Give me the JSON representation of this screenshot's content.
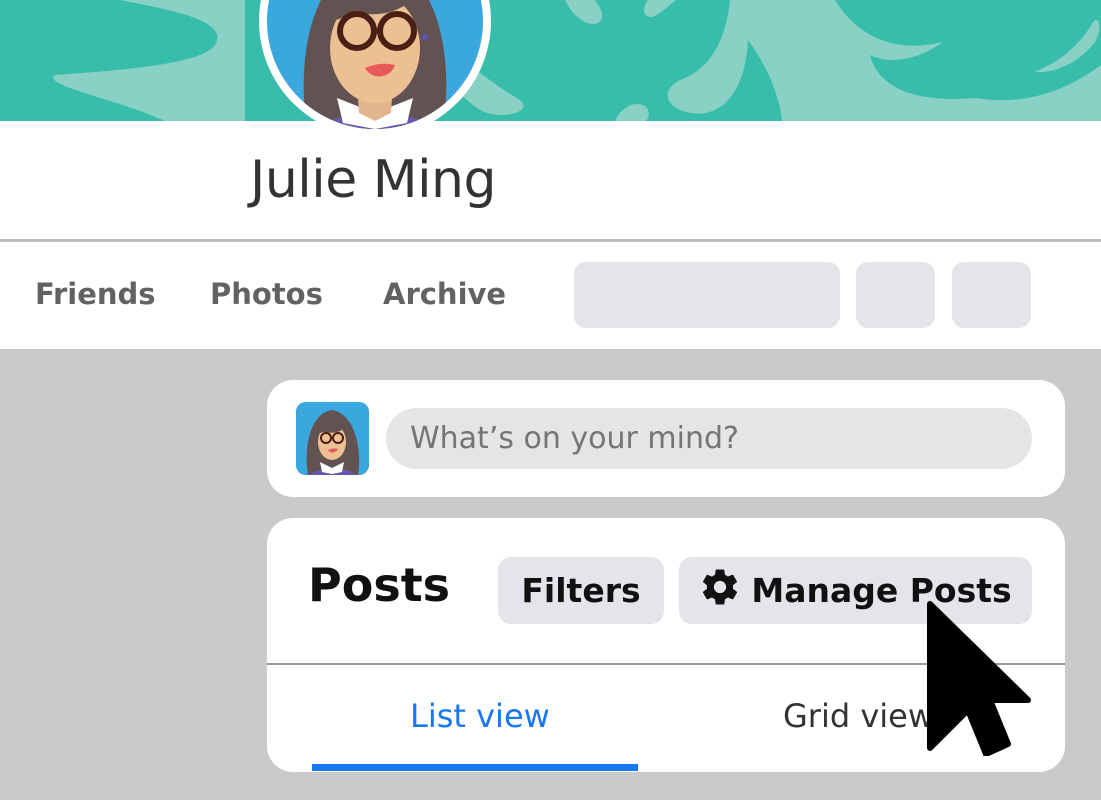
{
  "profile": {
    "name": "Julie Ming",
    "cover_colors": {
      "base": "#38bdaa",
      "splash": "#89d1c4"
    },
    "avatar_bg": "#3aa7de"
  },
  "nav": {
    "tabs": [
      {
        "label": "Friends"
      },
      {
        "label": "Photos"
      },
      {
        "label": "Archive"
      }
    ]
  },
  "composer": {
    "placeholder": "What’s on your mind?"
  },
  "posts": {
    "title": "Posts",
    "filters_label": "Filters",
    "manage_label": "Manage Posts",
    "manage_icon": "gear-icon",
    "view_tabs": [
      {
        "label": "List view",
        "active": true
      },
      {
        "label": "Grid view",
        "active": false
      }
    ],
    "accent_color": "#1877f2"
  }
}
